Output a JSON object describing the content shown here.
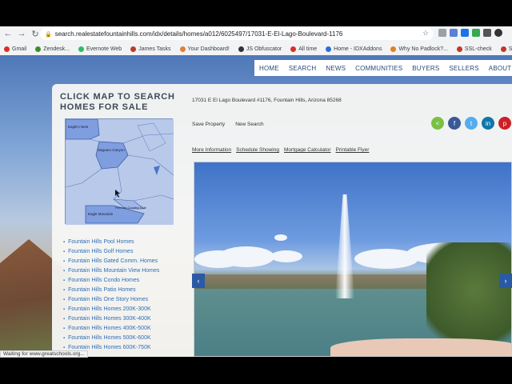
{
  "browser": {
    "url": "search.realestatefountainhills.com/idx/details/homes/a012/6025497/17031-E-El-Lago-Boulevard-1176",
    "bookmarks": [
      "Gmail",
      "Zendesk...",
      "Evernote Web",
      "James Tasks",
      "Your Dashboard!",
      "JS Obfuscator",
      "All time",
      "Home - IDXAddons",
      "Why No Padlock?...",
      "SSL-check",
      "Strong'"
    ],
    "status": "Waiting for www.greatschools.org..."
  },
  "nav": {
    "items": [
      "HOME",
      "SEARCH",
      "NEWS",
      "COMMUNITIES",
      "BUYERS",
      "SELLERS",
      "ABOUT"
    ]
  },
  "sidebar": {
    "title": "CLICK MAP TO SEARCH HOMES FOR SALE",
    "map_labels": [
      "Eagle's Nest",
      "Saguaro Canyon",
      "Firerock Country Club",
      "Eagle Mountain"
    ],
    "links": [
      "Fountain Hills Pool Homes",
      "Fountain Hills Golf Homes",
      "Fountain Hills Gated Comm. Homes",
      "Fountain Hills Mountain View Homes",
      "Fountain Hills Condo Homes",
      "Fountain Hills Patio Homes",
      "Fountain Hills One Story Homes",
      "Fountain Hills Homes 200K-300K",
      "Fountain Hills Homes 300K-400K",
      "Fountain Hills Homes 400K-500K",
      "Fountain Hills Homes 500K-600K",
      "Fountain Hills Homes 600K-750K"
    ]
  },
  "listing": {
    "address": "17031 E El Lago Boulevard #1176, Fountain Hills, Arizona 85268",
    "save_label": "Save Property",
    "new_search_label": "New Search",
    "tabs": [
      "More Information",
      "Schedule Showing",
      "Mortgage Calculator",
      "Printable Flyer"
    ]
  },
  "social": [
    {
      "name": "share",
      "glyph": "<",
      "color": "#7ac142"
    },
    {
      "name": "facebook",
      "glyph": "f",
      "color": "#3b5998"
    },
    {
      "name": "twitter",
      "glyph": "t",
      "color": "#55acee"
    },
    {
      "name": "linkedin",
      "glyph": "in",
      "color": "#0e76a8"
    },
    {
      "name": "pinterest",
      "glyph": "p",
      "color": "#cb2027"
    }
  ],
  "gallery": {
    "prev_glyph": "‹",
    "next_glyph": "›"
  }
}
